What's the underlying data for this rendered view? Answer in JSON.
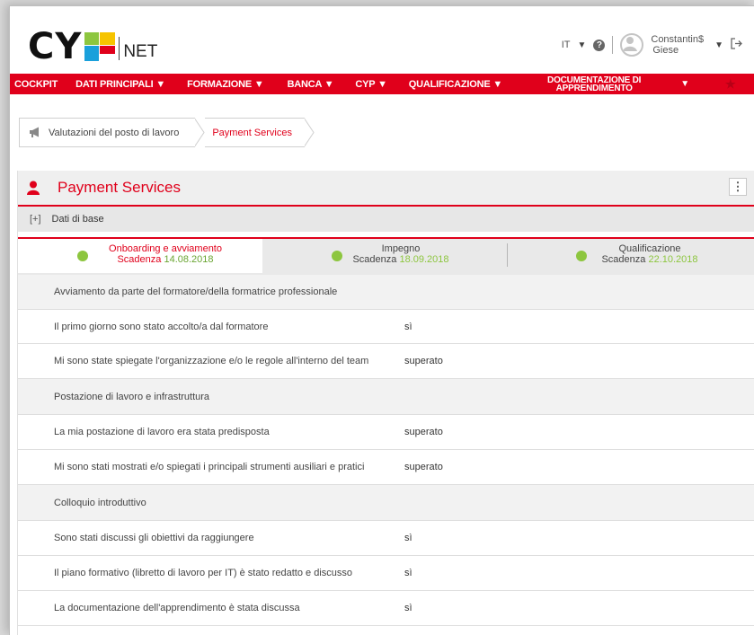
{
  "header": {
    "logo_text": "CY",
    "logo_suffix": "NET",
    "language": "IT",
    "help_label": "?",
    "user": {
      "first": "Constantin$",
      "last": "Giese"
    },
    "colors": {
      "brand_red": "#e0001b",
      "logo_green": "#8dc63f",
      "logo_yellow": "#f6c400",
      "logo_blue": "#1aa0db",
      "logo_red": "#e0001b"
    }
  },
  "nav": {
    "items": [
      {
        "label": "COCKPIT"
      },
      {
        "label": "DATI PRINCIPALI ▼"
      },
      {
        "label": "FORMAZIONE ▼"
      },
      {
        "label": "BANCA ▼"
      },
      {
        "label": "CYP ▼"
      },
      {
        "label": "QUALIFICAZIONE ▼"
      },
      {
        "label": "DOCUMENTAZIONE DI",
        "label2": "APPRENDIMENTO"
      }
    ],
    "last_arrow": "▼",
    "star": "★"
  },
  "breadcrumb": {
    "items": [
      {
        "label": "Valutazioni del posto di lavoro"
      },
      {
        "label": "Payment Services"
      }
    ]
  },
  "panel": {
    "title": "Payment Services",
    "menu_label": "⋮",
    "basic_toggle": "[+]",
    "basic_label": "Dati di base"
  },
  "tabs": [
    {
      "title": "Onboarding e avviamento",
      "deadline_label": "Scadenza",
      "deadline": "14.08.2018"
    },
    {
      "title": "Impegno",
      "deadline_label": "Scadenza",
      "deadline": "18.09.2018"
    },
    {
      "title": "Qualificazione",
      "deadline_label": "Scadenza",
      "deadline": "22.10.2018"
    }
  ],
  "rows": [
    {
      "type": "section",
      "label": "Avviamento da parte del formatore/della formatrice professionale"
    },
    {
      "type": "item",
      "label": "Il primo giorno sono stato accolto/a dal formatore",
      "value": "sì"
    },
    {
      "type": "item",
      "label": "Mi sono state spiegate l'organizzazione e/o le regole all'interno del team",
      "value": "superato"
    },
    {
      "type": "section",
      "label": "Postazione di lavoro e infrastruttura"
    },
    {
      "type": "item",
      "label": "La mia postazione di lavoro era stata predisposta",
      "value": "superato"
    },
    {
      "type": "item",
      "label": "Mi sono stati mostrati e/o spiegati i principali strumenti ausiliari e pratici",
      "value": "superato"
    },
    {
      "type": "section",
      "label": "Colloquio introduttivo"
    },
    {
      "type": "item",
      "label": "Sono stati discussi gli obiettivi da raggiungere",
      "value": "sì"
    },
    {
      "type": "item",
      "label": "Il piano formativo (libretto di lavoro per IT) è stato redatto e discusso",
      "value": "sì"
    },
    {
      "type": "item",
      "label": "La documentazione dell'apprendimento è stata discussa",
      "value": "sì"
    }
  ]
}
